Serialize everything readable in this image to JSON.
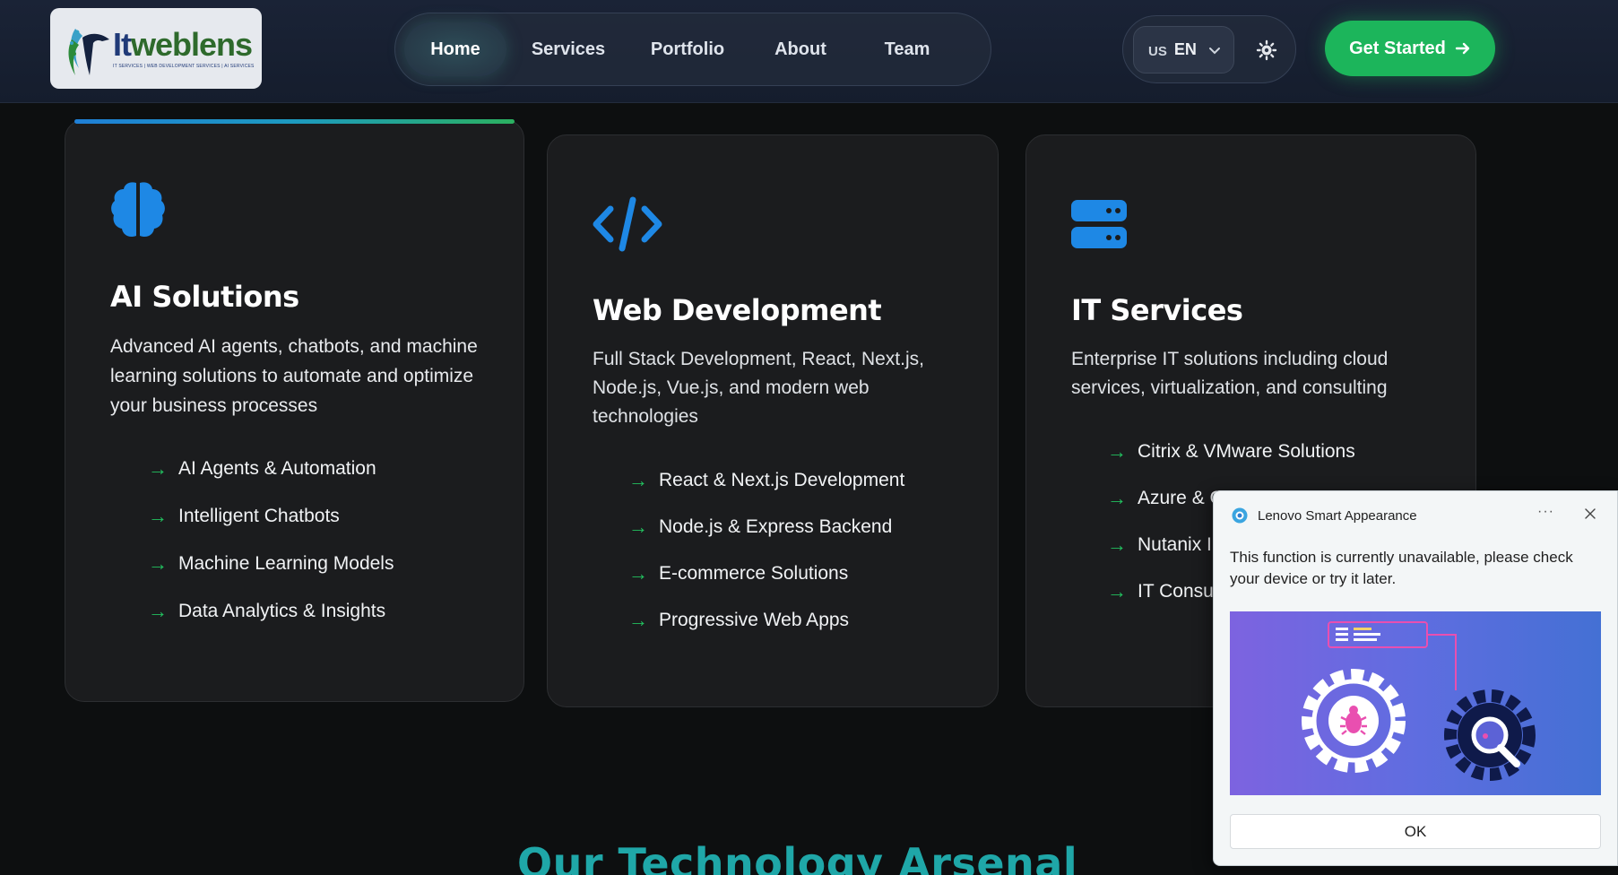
{
  "header": {
    "logo": {
      "word_it": "It",
      "word_rest": "weblens",
      "tagline": "IT SERVICES | WEB DEVELOPMENT SERVICES | AI SERVICES"
    },
    "nav": [
      {
        "label": "Home",
        "active": true
      },
      {
        "label": "Services",
        "active": false
      },
      {
        "label": "Portfolio",
        "active": false
      },
      {
        "label": "About",
        "active": false
      },
      {
        "label": "Team",
        "active": false
      }
    ],
    "language": {
      "flag": "US",
      "code": "EN"
    },
    "theme_icon": "sun-icon",
    "cta_label": "Get Started"
  },
  "cards": [
    {
      "icon": "brain-icon",
      "title": "AI Solutions",
      "description": "Advanced AI agents, chatbots, and machine learning solutions to automate and optimize your business processes",
      "features": [
        "AI Agents & Automation",
        "Intelligent Chatbots",
        "Machine Learning Models",
        "Data Analytics & Insights"
      ]
    },
    {
      "icon": "code-icon",
      "title": "Web Development",
      "description": "Full Stack Development, React, Next.js, Node.js, Vue.js, and modern web technologies",
      "features": [
        "React & Next.js Development",
        "Node.js & Express Backend",
        "E-commerce Solutions",
        "Progressive Web Apps"
      ]
    },
    {
      "icon": "server-icon",
      "title": "IT Services",
      "description": "Enterprise IT solutions including cloud services, virtualization, and consulting",
      "features": [
        "Citrix & VMware Solutions",
        "Azure & C",
        "Nutanix In",
        "IT Consul"
      ]
    }
  ],
  "section_heading": "Our Technology Arsenal",
  "feature_arrow": "→",
  "popup": {
    "app_name": "Lenovo Smart Appearance",
    "more": "···",
    "message": "This function is currently unavailable, please check your device or try it later.",
    "ok_label": "OK"
  },
  "colors": {
    "accent_green": "#1cb55b",
    "icon_blue": "#1e88e5",
    "heading_teal": "#1fa7a8"
  }
}
